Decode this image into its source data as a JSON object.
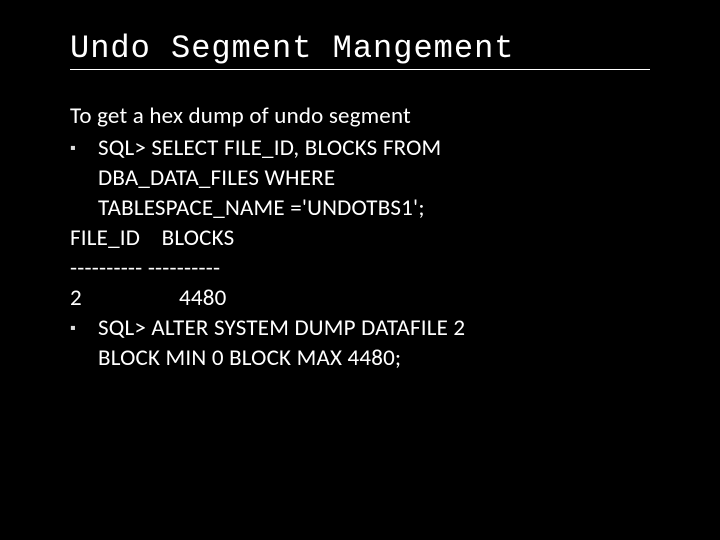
{
  "title": "Undo Segment Mangement",
  "intro": "To get a hex dump of undo segment",
  "bullet1": {
    "line1": "SQL> SELECT FILE_ID, BLOCKS FROM",
    "line2": "DBA_DATA_FILES WHERE",
    "line3": "TABLESPACE_NAME ='UNDOTBS1';"
  },
  "output": {
    "header": "FILE_ID    BLOCKS",
    "separator": "---------- ----------",
    "row": "2                  4480"
  },
  "bullet2": {
    "line1": "SQL> ALTER SYSTEM DUMP DATAFILE 2",
    "line2": "BLOCK MIN 0 BLOCK MAX 4480;"
  },
  "marker": "▪"
}
